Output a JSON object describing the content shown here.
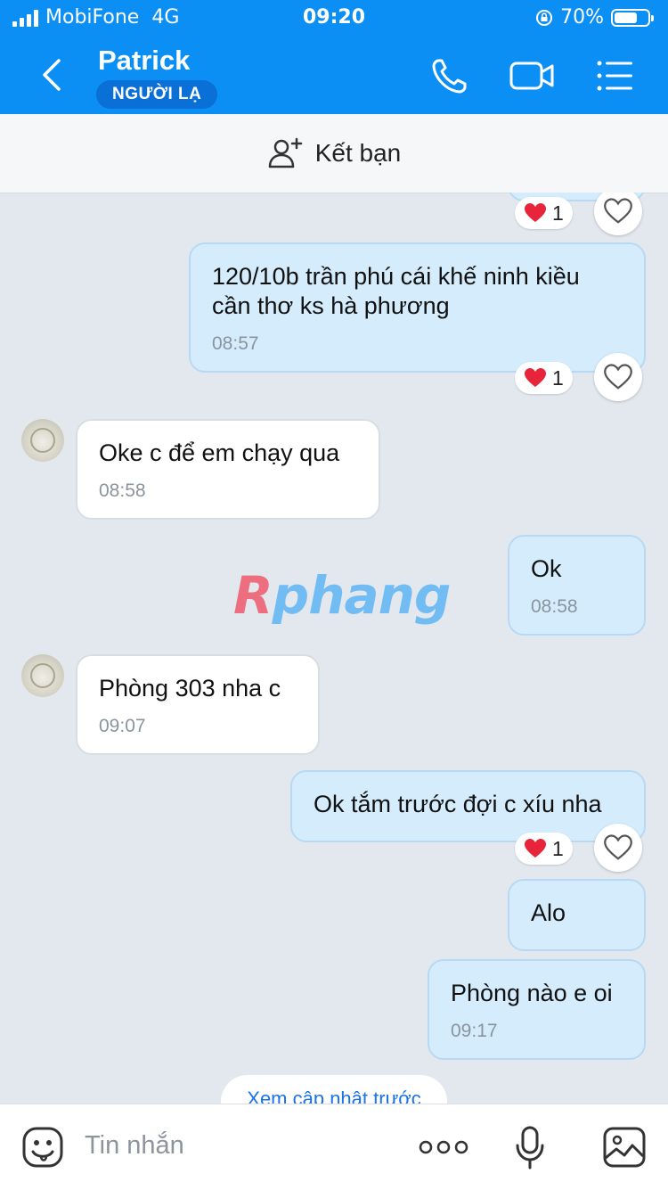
{
  "status_bar": {
    "carrier": "MobiFone",
    "network": "4G",
    "time": "09:20",
    "battery": "70%",
    "battery_level": 0.7
  },
  "header": {
    "contact_name": "Patrick",
    "contact_badge": "NGƯỜI LẠ",
    "icons": [
      "back-arrow-icon",
      "phone-icon",
      "video-call-icon",
      "menu-icon"
    ]
  },
  "add_friend": {
    "label": "Kết bạn"
  },
  "messages": [
    {
      "from": "me",
      "text": "120/10b trần phú cái khế ninh kiều cần thơ ks hà phương",
      "time": "08:57",
      "reaction": {
        "emoji": "heart",
        "count": "1"
      }
    },
    {
      "from": "them",
      "text": "Oke c để em chạy qua",
      "time": "08:58"
    },
    {
      "from": "me",
      "text": "Ok",
      "time": "08:58"
    },
    {
      "from": "them",
      "text": "Phòng 303 nha c",
      "time": "09:07"
    },
    {
      "from": "me",
      "text": "Ok tắm trước đợi c xíu nha",
      "reaction": {
        "emoji": "heart",
        "count": "1"
      }
    },
    {
      "from": "me",
      "text": "Alo"
    },
    {
      "from": "me",
      "text": "Phòng nào e oi",
      "time": "09:17"
    }
  ],
  "top_partial_reaction": {
    "emoji": "heart",
    "count": "1"
  },
  "watermark": {
    "part1": "R",
    "part2": "phang"
  },
  "see_older": "Xem cập nhật trước",
  "composer": {
    "placeholder": "Tin nhắn"
  },
  "colors": {
    "header_blue": "#0b8ff4",
    "my_bubble": "#d4ecfc",
    "chat_bg": "#e3e8ef",
    "reaction_heart": "#e8243a"
  }
}
